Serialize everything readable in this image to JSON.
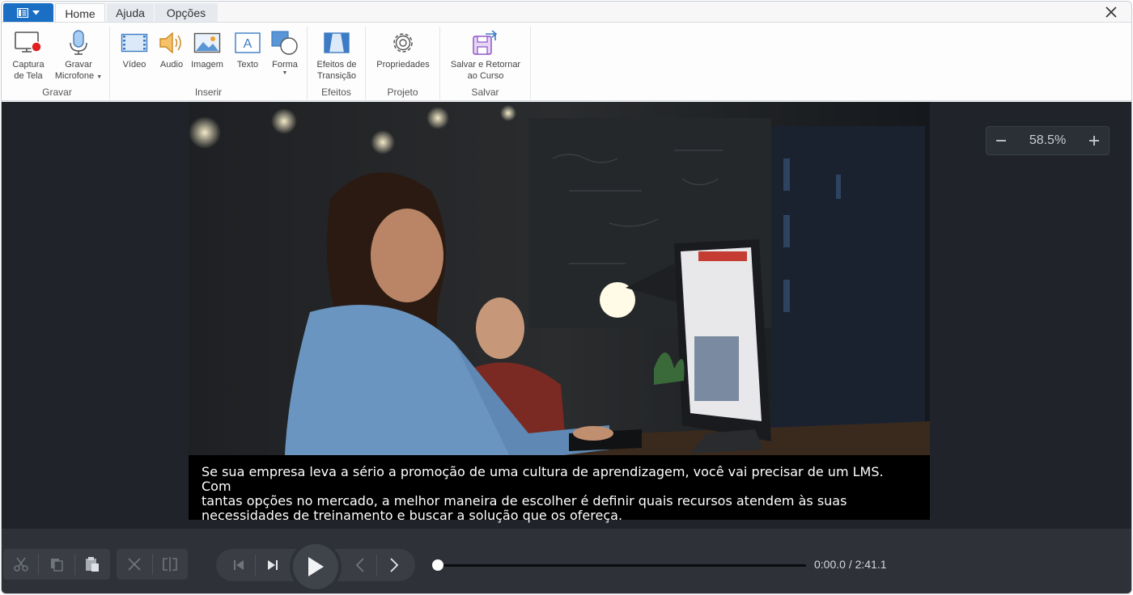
{
  "tabs": {
    "home": "Home",
    "ajuda": "Ajuda",
    "opcoes": "Opções"
  },
  "ribbon": {
    "gravar": {
      "label": "Gravar",
      "captura_line1": "Captura",
      "captura_line2": "de Tela",
      "microfone_line1": "Gravar",
      "microfone_line2": "Microfone"
    },
    "inserir": {
      "label": "Inserir",
      "video": "Vídeo",
      "audio": "Audio",
      "imagem": "Imagem",
      "texto": "Texto",
      "forma": "Forma"
    },
    "efeitos": {
      "label": "Efeitos",
      "line1": "Efeitos de",
      "line2": "Transição"
    },
    "projeto": {
      "label": "Projeto",
      "propriedades": "Propriedades"
    },
    "salvar": {
      "label": "Salvar",
      "line1": "Salvar e Retornar",
      "line2": "ao Curso"
    }
  },
  "caption": {
    "line1": "Se sua empresa leva a sério a promoção de uma cultura de aprendizagem, você vai precisar de um LMS. Com",
    "line2": "tantas opções no mercado, a melhor maneira de escolher é definir quais recursos atendem às suas",
    "line3": "necessidades de treinamento e buscar a solução que os ofereça."
  },
  "zoom": {
    "value": "58.5%"
  },
  "player": {
    "timecode": "0:00.0 / 2:41.1",
    "progress": 0
  },
  "colors": {
    "accent": "#1a6fc4",
    "stage": "#20232a",
    "controls": "#2e3138"
  }
}
